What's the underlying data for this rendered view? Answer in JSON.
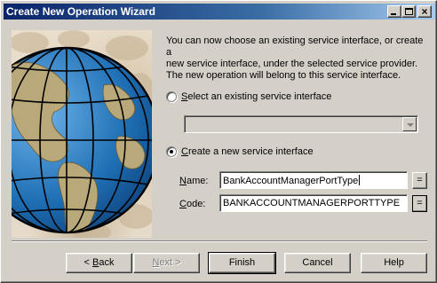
{
  "window": {
    "title": "Create New Operation Wizard",
    "title_bar_buttons": [
      "minimize",
      "maximize",
      "close"
    ],
    "close_glyph": "×"
  },
  "intro_text": "You can now choose an existing service interface, or create a\nnew service interface, under the selected service provider.\nThe new operation will belong to this service interface.",
  "options": {
    "existing": {
      "label_prefix": "",
      "label_mnemonic": "S",
      "label_rest": "elect an existing service interface",
      "selected": false,
      "combo_value": ""
    },
    "create": {
      "label_prefix": "",
      "label_mnemonic": "C",
      "label_rest": "reate a new service interface",
      "selected": true
    }
  },
  "fields": {
    "name": {
      "label_mnemonic": "N",
      "label_rest": "ame:",
      "value": "BankAccountManagerPortType",
      "eq_label": "="
    },
    "code": {
      "label_mnemonic": "C",
      "label_rest": "ode:",
      "value": "BANKACCOUNTMANAGERPORTTYPE",
      "eq_label": "="
    }
  },
  "buttons": {
    "back": {
      "arrow": "< ",
      "mnemonic": "B",
      "rest": "ack"
    },
    "next": {
      "mnemonic": "N",
      "rest": "ext",
      "arrow": " >"
    },
    "finish": "Finish",
    "cancel": "Cancel",
    "help": "Help"
  },
  "colors": {
    "title_bar_start": "#0a246a",
    "title_bar_end": "#a6caf0",
    "dialog_face": "#d4d0c8",
    "globe_ocean": "#1f6fb5",
    "globe_land": "#b9a97a"
  },
  "icons": {
    "side_image": "globe-illustration"
  }
}
